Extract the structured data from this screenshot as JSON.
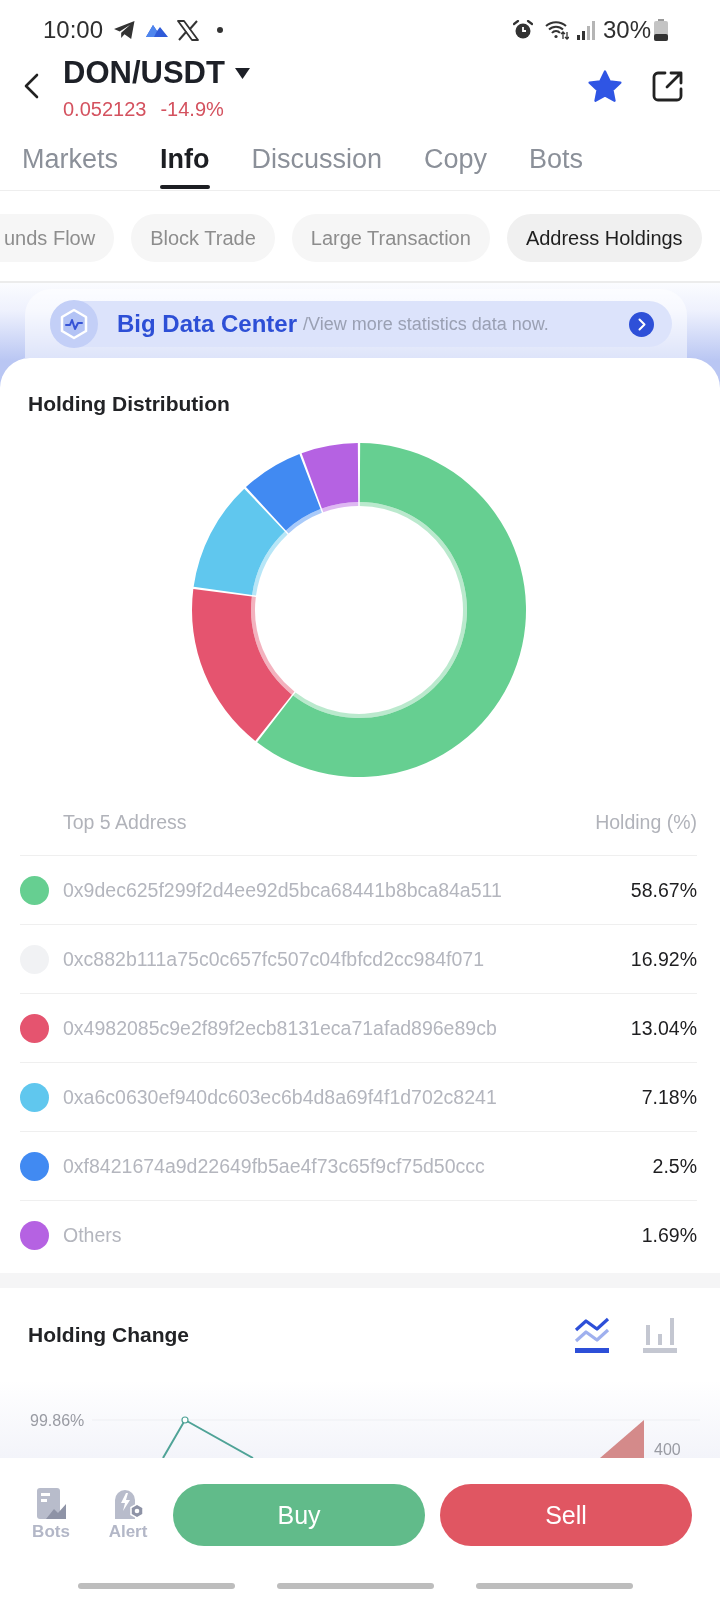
{
  "status_bar": {
    "time": "10:00",
    "battery": "30%"
  },
  "header": {
    "pair": "DON/USDT",
    "price": "0.052123",
    "change": "-14.9%",
    "favorite": true
  },
  "tabs": [
    {
      "label": "Markets",
      "selected": false
    },
    {
      "label": "Info",
      "selected": true
    },
    {
      "label": "Discussion",
      "selected": false
    },
    {
      "label": "Copy",
      "selected": false
    },
    {
      "label": "Bots",
      "selected": false
    }
  ],
  "chips": [
    {
      "label": "unds Flow",
      "selected": false
    },
    {
      "label": "Block Trade",
      "selected": false
    },
    {
      "label": "Large Transaction",
      "selected": false
    },
    {
      "label": "Address Holdings",
      "selected": true
    }
  ],
  "banner": {
    "title": "Big Data Center",
    "subtitle": "/View more statistics data now."
  },
  "holding_distribution": {
    "title": "Holding Distribution",
    "columns": [
      "Top 5 Address",
      "Holding (%)"
    ],
    "rows": [
      {
        "address": "0x9dec625f299f2d4ee92d5bca68441b8bca84a511",
        "holding": "58.67%",
        "color": "#66cf91"
      },
      {
        "address": "0xc882b111a75c0c657fc507c04fbfcd2cc984f071",
        "holding": "16.92%",
        "color": "#f1f2f4"
      },
      {
        "address": "0x4982085c9e2f89f2ecb8131eca71afad896e89cb",
        "holding": "13.04%",
        "color": "#e5546f"
      },
      {
        "address": "0xa6c0630ef940dc603ec6b4d8a69f4f1d702c8241",
        "holding": "7.18%",
        "color": "#60c7ee"
      },
      {
        "address": "0xf8421674a9d22649fb5ae4f73c65f9cf75d50ccc",
        "holding": "2.5%",
        "color": "#418af2"
      },
      {
        "address": "Others",
        "holding": "1.69%",
        "color": "#b562e2"
      }
    ]
  },
  "holding_change": {
    "title": "Holding Change",
    "views": [
      {
        "kind": "line",
        "selected": true
      },
      {
        "kind": "bar",
        "selected": false
      }
    ],
    "left_axis_label": "99.86%",
    "right_axis_label": "400"
  },
  "bottom_bar": {
    "shortcuts": [
      {
        "kind": "bots",
        "label": "Bots"
      },
      {
        "kind": "alert",
        "label": "Alert"
      }
    ],
    "buy": "Buy",
    "sell": "Sell"
  }
}
